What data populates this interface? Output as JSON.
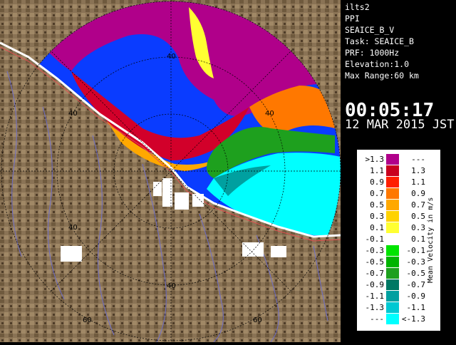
{
  "radar": {
    "station": "ilts2",
    "scan_type": "PPI",
    "product": "SEAICE_B_V",
    "task": "Task: SEAICE_B",
    "prf": "PRF: 1000Hz",
    "elevation": "Elevation:1.0",
    "max_range": "Max Range:60 km",
    "time": "00:05:17",
    "date": "12 MAR 2015 JST"
  },
  "legend": {
    "title": "Mean Velocity in m/s",
    "rows": [
      {
        "left": ">1.3",
        "right": "---",
        "color": "#b0008a"
      },
      {
        "left": "1.1",
        "right": "1.3",
        "color": "#c8001e"
      },
      {
        "left": "0.9",
        "right": "1.1",
        "color": "#ff1e00"
      },
      {
        "left": "0.7",
        "right": "0.9",
        "color": "#ff7800"
      },
      {
        "left": "0.5",
        "right": "0.7",
        "color": "#ffa800"
      },
      {
        "left": "0.3",
        "right": "0.5",
        "color": "#ffd200"
      },
      {
        "left": "0.1",
        "right": "0.3",
        "color": "#ffff32"
      },
      {
        "left": "-0.1",
        "right": "0.1",
        "color": "#ffffff"
      },
      {
        "left": "-0.3",
        "right": "-0.1",
        "color": "#00e400"
      },
      {
        "left": "-0.5",
        "right": "-0.3",
        "color": "#00b400"
      },
      {
        "left": "-0.7",
        "right": "-0.5",
        "color": "#1ea01e"
      },
      {
        "left": "-0.9",
        "right": "-0.7",
        "color": "#007864"
      },
      {
        "left": "-1.1",
        "right": "-0.9",
        "color": "#00a0a0"
      },
      {
        "left": "-1.3",
        "right": "-1.1",
        "color": "#00c8d2"
      },
      {
        "left": "---",
        "right": "<-1.3",
        "color": "#00ffff"
      }
    ]
  },
  "map_labels": {
    "range_40": "40",
    "range_60": "60"
  },
  "colors": {
    "terrain": "#8a7355",
    "terrain_dark": "#5e4a32",
    "sea_ice_background": "#0a3cff",
    "river": "#6e6ec8",
    "coast_road": "#e05050"
  }
}
